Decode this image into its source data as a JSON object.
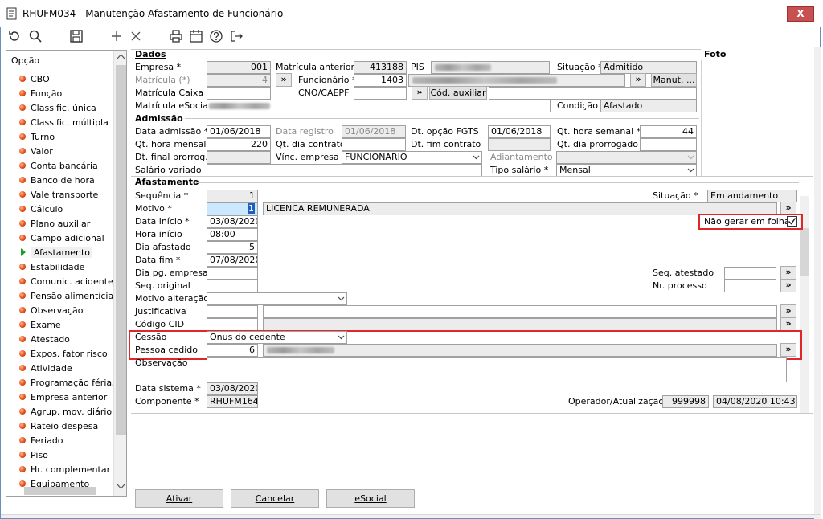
{
  "window": {
    "title": "RHUFM034 - Manutenção Afastamento de Funcionário",
    "close_label": "X"
  },
  "toolbar": {
    "icons": [
      "refresh-icon",
      "search-icon",
      "save-icon",
      "add-icon",
      "delete-icon",
      "print-icon",
      "calendar-icon",
      "help-icon",
      "exit-icon"
    ]
  },
  "sidebar": {
    "header": "Opção",
    "items": [
      {
        "label": "CBO"
      },
      {
        "label": "Função"
      },
      {
        "label": "Classific. única"
      },
      {
        "label": "Classific. múltipla"
      },
      {
        "label": "Turno"
      },
      {
        "label": "Valor"
      },
      {
        "label": "Conta bancária"
      },
      {
        "label": "Banco de hora"
      },
      {
        "label": "Vale transporte"
      },
      {
        "label": "Cálculo"
      },
      {
        "label": "Plano auxiliar"
      },
      {
        "label": "Campo adicional"
      },
      {
        "label": "Afastamento",
        "active": true
      },
      {
        "label": "Estabilidade"
      },
      {
        "label": "Comunic. acidente"
      },
      {
        "label": "Pensão alimentícia"
      },
      {
        "label": "Observação"
      },
      {
        "label": "Exame"
      },
      {
        "label": "Atestado"
      },
      {
        "label": "Expos. fator risco"
      },
      {
        "label": "Atividade"
      },
      {
        "label": "Programação férias"
      },
      {
        "label": "Empresa anterior"
      },
      {
        "label": "Agrup. mov. diário"
      },
      {
        "label": "Rateio despesa"
      },
      {
        "label": "Feriado"
      },
      {
        "label": "Piso"
      },
      {
        "label": "Hr. complementar"
      },
      {
        "label": "Equipamento"
      }
    ]
  },
  "dados": {
    "title": "Dados",
    "foto_title": "Foto",
    "empresa_label": "Empresa *",
    "empresa_value": "001",
    "matricula_ant_label": "Matrícula anterior",
    "matricula_ant_value": "413188",
    "pis_label": "PIS",
    "situacao_label": "Situação *",
    "situacao_value": "Admitido",
    "matricula_label": "Matrícula (*)",
    "matricula_value": "4",
    "funcionario_label": "Funcionário *",
    "funcionario_value": "1403",
    "manut_label": "Manut. ...",
    "matricula_caixa_label": "Matrícula Caixa",
    "cno_label": "CNO/CAEPF",
    "cod_aux_label": "Cód. auxiliar",
    "matricula_esocial_label": "Matrícula eSocial",
    "condicao_label": "Condição",
    "condicao_value": "Afastado"
  },
  "admissao": {
    "title": "Admissão",
    "data_adm_label": "Data admissão *",
    "data_adm_value": "01/06/2018",
    "data_reg_label": "Data registro",
    "data_reg_value": "01/06/2018",
    "dt_fgts_label": "Dt. opção FGTS",
    "dt_fgts_value": "01/06/2018",
    "qt_semanal_label": "Qt. hora semanal *",
    "qt_semanal_value": "44",
    "qt_mensal_label": "Qt. hora mensal *",
    "qt_mensal_value": "220",
    "qt_dia_label": "Qt. dia contrato",
    "dt_fim_label": "Dt. fim contrato",
    "qt_prorrog_label": "Qt. dia prorrogado",
    "dt_final_label": "Dt. final prorrog.",
    "vinc_label": "Vínc. empresa *",
    "vinc_value": "FUNCIONARIO",
    "adiant_label": "Adiantamento",
    "salario_var_label": "Salário variado",
    "tipo_sal_label": "Tipo salário *",
    "tipo_sal_value": "Mensal"
  },
  "afastamento": {
    "title": "Afastamento",
    "sequencia_label": "Sequência *",
    "sequencia_value": "1",
    "situacao_label": "Situação *",
    "situacao_value": "Em andamento",
    "motivo_label": "Motivo *",
    "motivo_value": "1",
    "motivo_desc": "LICENCA REMUNERADA",
    "nao_gerar_label": "Não gerar em folha",
    "data_inicio_label": "Data início *",
    "data_inicio_value": "03/08/2020",
    "hora_inicio_label": "Hora início",
    "hora_inicio_value": "08:00",
    "dia_afast_label": "Dia afastado",
    "dia_afast_value": "5",
    "data_fim_label": "Data fim *",
    "data_fim_value": "07/08/2020",
    "dia_pg_label": "Dia pg. empresa",
    "seq_atestado_label": "Seq. atestado",
    "seq_original_label": "Seq. original",
    "nr_processo_label": "Nr. processo",
    "motivo_alt_label": "Motivo alteração",
    "justificativa_label": "Justificativa",
    "codigo_cid_label": "Código CID",
    "cessao_label": "Cessão",
    "cessao_value": "Onus do cedente",
    "pessoa_label": "Pessoa cedido",
    "pessoa_value": "6",
    "observacao_label": "Observação",
    "data_sistema_label": "Data sistema *",
    "data_sistema_value": "03/08/2020",
    "componente_label": "Componente *",
    "componente_value": "RHUFM164",
    "operador_label": "Operador/Atualização",
    "operador_value": "999998",
    "atualizacao_value": "04/08/2020 10:43:00"
  },
  "footer": {
    "ativar": "Ativar",
    "cancelar": "Cancelar",
    "esocial": "eSocial"
  },
  "arrow_label": "»",
  "colors": {
    "highlight": "#e0262b",
    "active_field": "#cce8ff",
    "title_bg": "#ffffff"
  }
}
